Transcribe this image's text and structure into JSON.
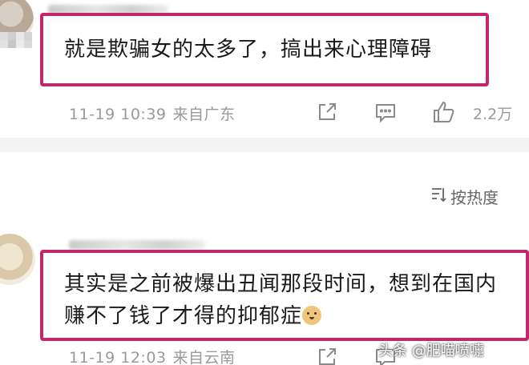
{
  "comments": [
    {
      "text": "就是欺骗女的太多了，搞出来心理障碍",
      "time": "11-19 10:39",
      "source": "来自广东",
      "like_count": "2.2万"
    },
    {
      "text": "其实是之前被爆出丑闻那段时间，想到在国内赚不了钱了才得的抑郁症",
      "time": "11-19 12:03",
      "source": "来自云南"
    }
  ],
  "sort": {
    "label": "按热度",
    "icon": "sort-icon"
  },
  "icons": {
    "share": "share-icon",
    "comment": "comment-icon",
    "like": "thumbs-up-icon",
    "emoji": "doge-emoji-icon"
  },
  "watermark": "头条 @肥喵喷嚏",
  "colors": {
    "highlight_border": "#c3266b",
    "meta_text": "#9a9a9a",
    "divider": "#f3f3f3"
  }
}
